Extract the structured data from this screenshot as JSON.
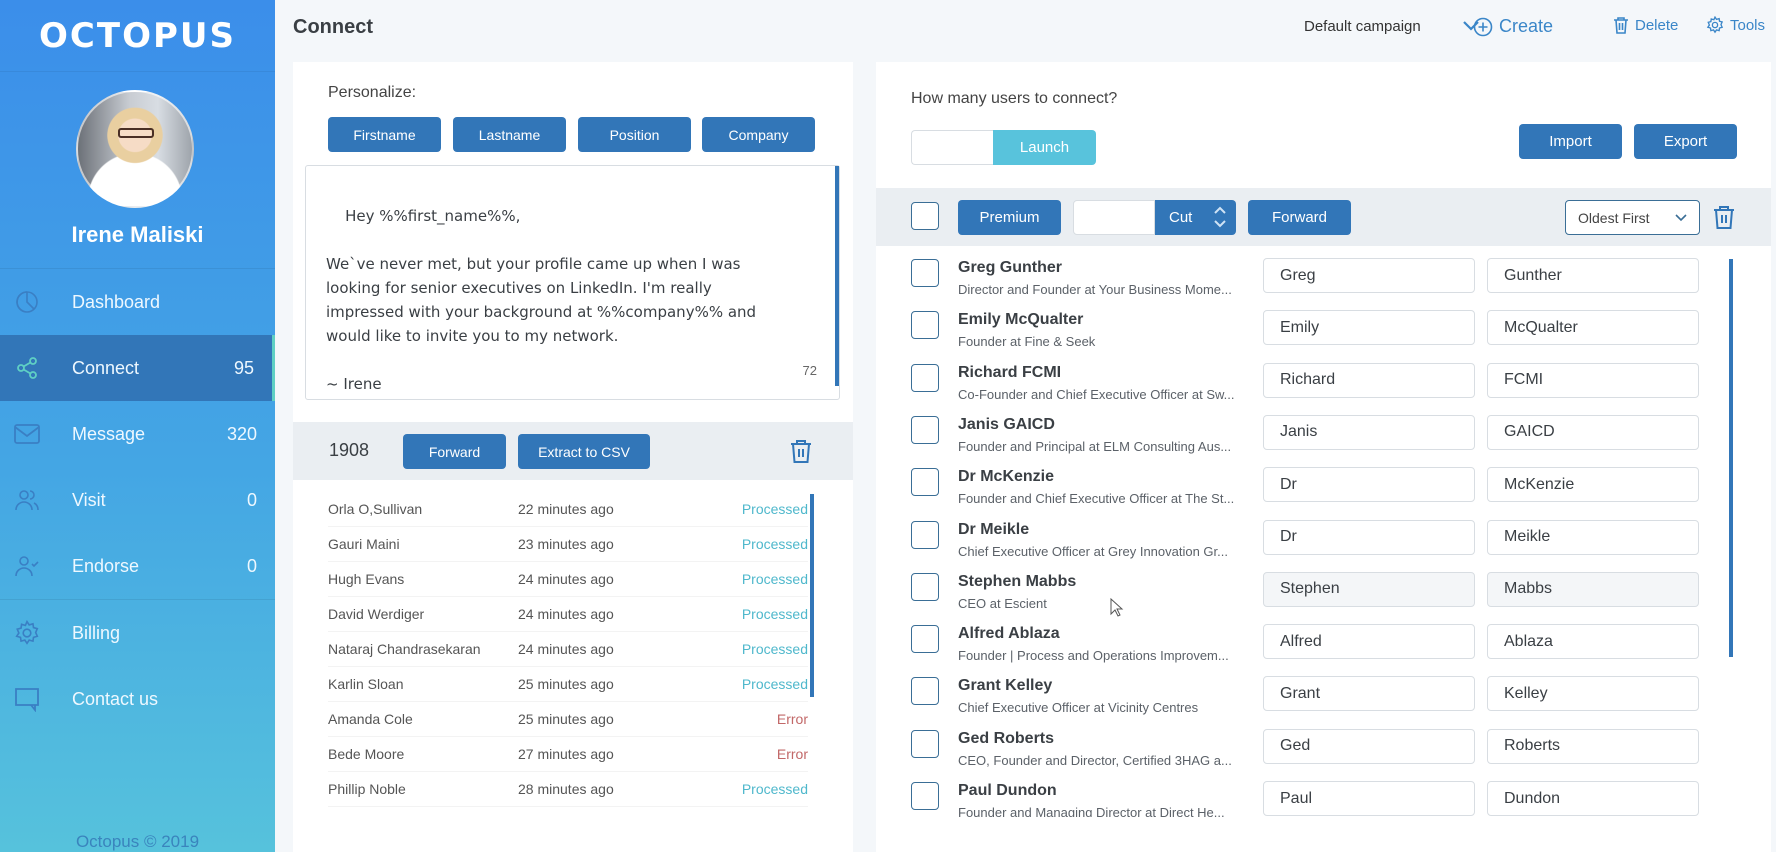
{
  "app": {
    "logo": "OCTOPUS",
    "user_name": "Irene Maliski",
    "footer": "Octopus © 2019"
  },
  "sidebar": {
    "items": [
      {
        "label": "Dashboard",
        "count": "",
        "icon": "pie-chart-icon"
      },
      {
        "label": "Connect",
        "count": "95",
        "icon": "share-icon",
        "active": true
      },
      {
        "label": "Message",
        "count": "320",
        "icon": "mail-icon"
      },
      {
        "label": "Visit",
        "count": "0",
        "icon": "users-icon"
      },
      {
        "label": "Endorse",
        "count": "0",
        "icon": "user-check-icon"
      },
      {
        "label": "Billing",
        "count": "",
        "icon": "gear-icon"
      },
      {
        "label": "Contact us",
        "count": "",
        "icon": "chat-icon"
      }
    ]
  },
  "header": {
    "title": "Connect",
    "campaign": "Default campaign",
    "create_label": "Create",
    "delete_label": "Delete",
    "tools_label": "Tools"
  },
  "composer": {
    "personalize_label": "Personalize:",
    "tags": [
      "Firstname",
      "Lastname",
      "Position",
      "Company"
    ],
    "message": "Hey %%first_name%%,\n\nWe`ve never met, but your profile came up when I was\nlooking for senior executives on LinkedIn. I'm really\nimpressed with your background at %%company%% and\nwould like to invite you to my network.\n\n~ Irene",
    "char_count": "72"
  },
  "log": {
    "count": "1908",
    "forward_label": "Forward",
    "extract_label": "Extract to CSV",
    "rows": [
      {
        "name": "Orla O,Sullivan",
        "time": "22 minutes ago",
        "status": "Processed"
      },
      {
        "name": "Gauri Maini",
        "time": "23 minutes ago",
        "status": "Processed"
      },
      {
        "name": "Hugh Evans",
        "time": "24 minutes ago",
        "status": "Processed"
      },
      {
        "name": "David Werdiger",
        "time": "24 minutes ago",
        "status": "Processed"
      },
      {
        "name": "Nataraj Chandrasekaran",
        "time": "24 minutes ago",
        "status": "Processed"
      },
      {
        "name": "Karlin Sloan",
        "time": "25 minutes ago",
        "status": "Processed"
      },
      {
        "name": "Amanda Cole",
        "time": "25 minutes ago",
        "status": "Error"
      },
      {
        "name": "Bede Moore",
        "time": "27 minutes ago",
        "status": "Error"
      },
      {
        "name": "Phillip Noble",
        "time": "28 minutes ago",
        "status": "Processed"
      }
    ]
  },
  "launcher": {
    "question": "How many users to connect?",
    "quantity_value": "",
    "launch_label": "Launch",
    "import_label": "Import",
    "export_label": "Export"
  },
  "contacts_toolbar": {
    "premium_label": "Premium",
    "cut_value": "",
    "cut_label": "Cut",
    "forward_label": "Forward",
    "sort_selected": "Oldest First"
  },
  "contacts": [
    {
      "name": "Greg Gunther",
      "title": "Director and Founder at Your Business Mome...",
      "first": "Greg",
      "last": "Gunther"
    },
    {
      "name": "Emily McQualter",
      "title": "Founder at Fine & Seek",
      "first": "Emily",
      "last": "McQualter"
    },
    {
      "name": "Richard FCMI",
      "title": "Co-Founder and Chief Executive Officer at Sw...",
      "first": "Richard",
      "last": "FCMI"
    },
    {
      "name": "Janis GAICD",
      "title": "Founder and Principal at ELM Consulting Aus...",
      "first": "Janis",
      "last": "GAICD"
    },
    {
      "name": "Dr McKenzie",
      "title": "Founder and Chief Executive Officer at The St...",
      "first": "Dr",
      "last": "McKenzie"
    },
    {
      "name": "Dr Meikle",
      "title": "Chief Executive Officer at Grey Innovation Gr...",
      "first": "Dr",
      "last": "Meikle"
    },
    {
      "name": "Stephen Mabbs",
      "title": "CEO at Escient",
      "first": "Stephen",
      "last": "Mabbs"
    },
    {
      "name": "Alfred Ablaza",
      "title": "Founder | Process and Operations Improvem...",
      "first": "Alfred",
      "last": "Ablaza"
    },
    {
      "name": "Grant Kelley",
      "title": "Chief Executive Officer at Vicinity Centres",
      "first": "Grant",
      "last": "Kelley"
    },
    {
      "name": "Ged Roberts",
      "title": "CEO, Founder and Director, Certified 3HAG a...",
      "first": "Ged",
      "last": "Roberts"
    },
    {
      "name": "Paul Dundon",
      "title": "Founder and Managing Director at Direct He...",
      "first": "Paul",
      "last": "Dundon"
    }
  ],
  "colors": {
    "primary": "#3276b8",
    "accent_cyan": "#58c3dc",
    "processed": "#4fb8cc",
    "error": "#c26868"
  }
}
